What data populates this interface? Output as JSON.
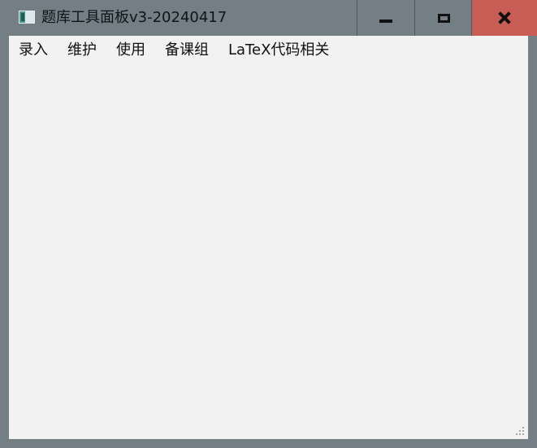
{
  "window": {
    "title": "题库工具面板v3-20240417"
  },
  "menubar": {
    "items": [
      {
        "label": "录入"
      },
      {
        "label": "维护"
      },
      {
        "label": "使用"
      },
      {
        "label": "备课组"
      },
      {
        "label": "LaTeX代码相关"
      }
    ]
  },
  "colors": {
    "frame": "#737f84",
    "client": "#f2f2f2",
    "close_button": "#c85d55"
  },
  "icons": {
    "app": "app-window-icon",
    "minimize": "minimize-icon",
    "maximize": "maximize-icon",
    "close": "close-icon",
    "resize": "resize-grip-icon"
  }
}
